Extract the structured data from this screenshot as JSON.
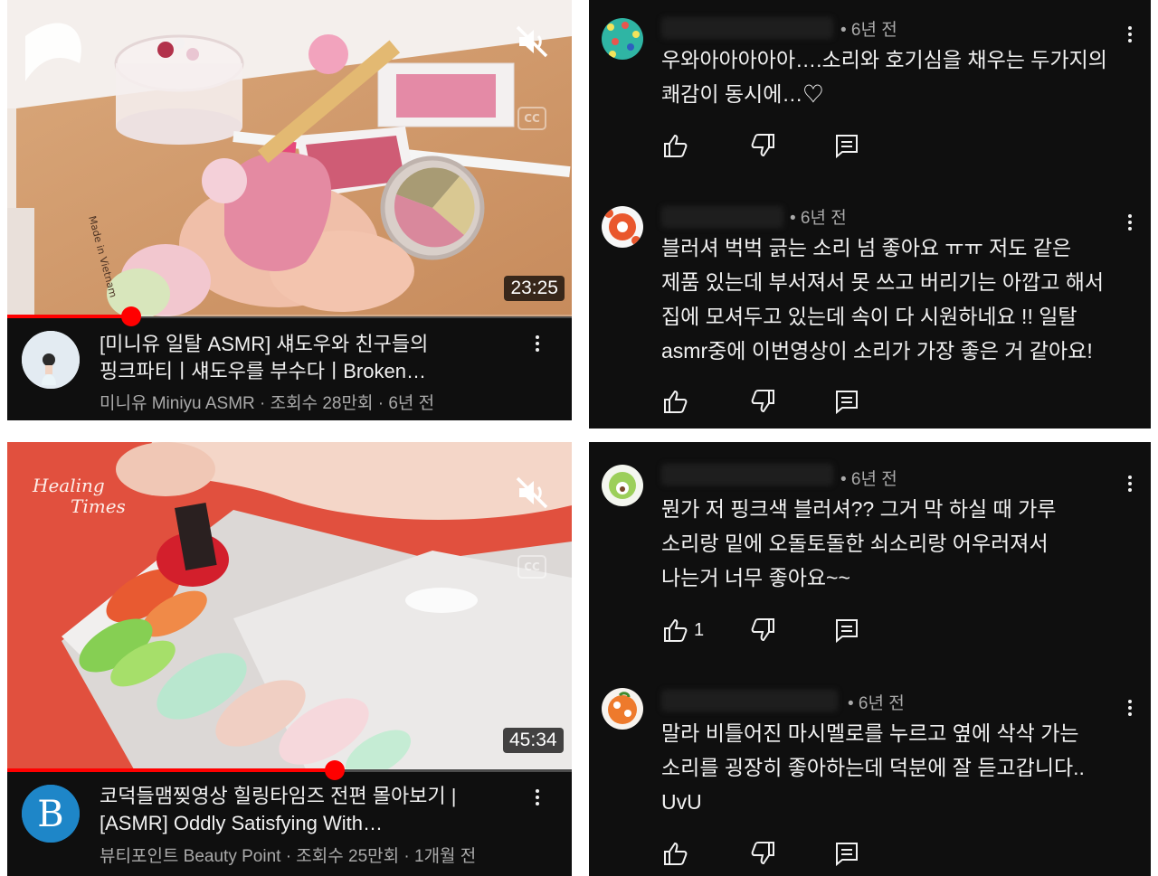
{
  "videos": [
    {
      "duration": "23:25",
      "progress": 0.22,
      "title_line1": "[미니유 일탈 ASMR] 섀도우와 친구들의",
      "title_line2": "핑크파티ㅣ섀도우를 부수다ㅣBroken…",
      "meta": "미니유 Miniyu ASMR · 조회수 28만회 · 6년 전",
      "thumb_text": "Made in Vietnam",
      "icons": [
        "mute-icon",
        "cc-icon",
        "more-vert-icon"
      ]
    },
    {
      "duration": "45:34",
      "progress": 0.58,
      "title_line1": "코덕들맴찢영상 힐링타임즈 전편 몰아보기 |",
      "title_line2": "[ASMR] Oddly Satisfying With…",
      "meta": "뷰티포인트 Beauty Point · 조회수 25만회 · 1개월 전",
      "thumb_logo_line1": "Healing",
      "thumb_logo_line2": "Times",
      "channel_logo": "B",
      "icons": [
        "mute-icon",
        "cc-icon",
        "more-vert-icon"
      ]
    }
  ],
  "comments": [
    {
      "time": "• 6년 전",
      "lines": [
        "우와아아아아아….소리와 호기심을 채우는 두가지의",
        "쾌감이 동시에…♡"
      ],
      "likes": ""
    },
    {
      "time": "• 6년 전",
      "lines": [
        "블러셔 벅벅 긁는 소리 넘 좋아요 ㅠㅠ 저도 같은",
        "제품 있는데 부서져서 못 쓰고 버리기는 아깝고 해서",
        "집에 모셔두고 있는데 속이 다 시원하네요 !! 일탈",
        "asmr중에 이번영상이 소리가 가장 좋은 거 같아요!"
      ],
      "likes": ""
    },
    {
      "time": "• 6년 전",
      "lines": [
        "뭔가 저 핑크색 블러셔?? 그거 막 하실 때 가루",
        "소리랑 밑에 오돌토돌한 쇠소리랑 어우러져서",
        "나는거 너무 좋아요~~"
      ],
      "likes": "1"
    },
    {
      "time": "• 6년 전",
      "lines": [
        "말라 비틀어진 마시멜로를 누르고 옆에 삭삭 가는",
        "소리를 굉장히 좋아하는데 덕분에 잘 듣고갑니다..",
        "UvU"
      ],
      "likes": ""
    }
  ],
  "comment_icons": [
    "thumbs-up-icon",
    "thumbs-down-icon",
    "reply-icon",
    "more-vert-icon"
  ],
  "colors": {
    "background": "#0f0f0f",
    "text": "#f1f1f1",
    "secondary_text": "#aaaaaa",
    "progress": "#ff0000",
    "thumb2_bg": "#e1503e"
  }
}
